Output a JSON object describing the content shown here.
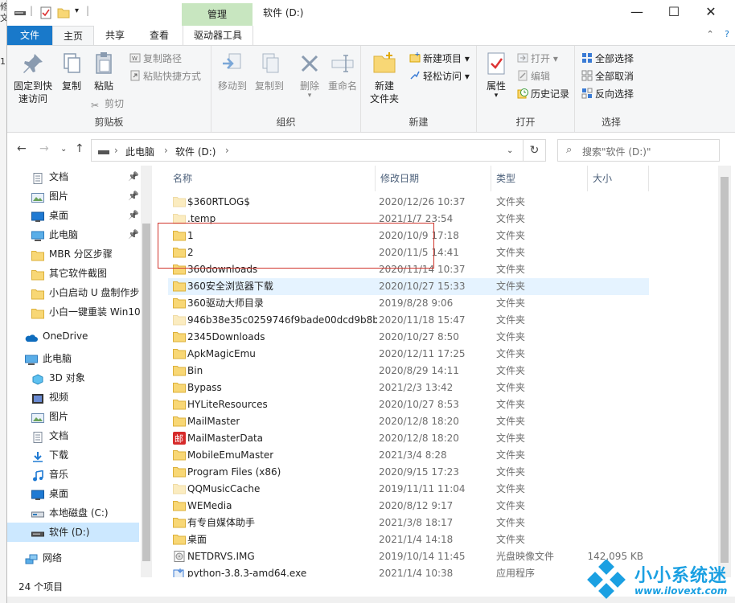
{
  "window": {
    "title": "软件 (D:)",
    "manage_tab": "管理"
  },
  "ribbon_tabs": {
    "file": "文件",
    "home": "主页",
    "share": "共享",
    "view": "查看",
    "drive_tools": "驱动器工具"
  },
  "ribbon": {
    "clipboard": {
      "label": "剪贴板",
      "pin_quick_access": "固定到快\n速访问",
      "copy": "复制",
      "paste": "粘贴",
      "copy_path": "复制路径",
      "paste_shortcut": "粘贴快捷方式",
      "cut": "剪切"
    },
    "organize": {
      "label": "组织",
      "move_to": "移动到",
      "copy_to": "复制到",
      "delete": "删除",
      "rename": "重命名"
    },
    "new": {
      "label": "新建",
      "new_folder": "新建\n文件夹",
      "new_item": "新建项目",
      "easy_access": "轻松访问"
    },
    "open": {
      "label": "打开",
      "properties": "属性",
      "open": "打开",
      "edit": "编辑",
      "history": "历史记录"
    },
    "select": {
      "label": "选择",
      "select_all": "全部选择",
      "select_none": "全部取消",
      "invert": "反向选择"
    }
  },
  "address": {
    "crumb_pc": "此电脑",
    "crumb_drive": "软件 (D:)",
    "search_placeholder": "搜索\"软件 (D:)\""
  },
  "nav_pane": {
    "quick": [
      {
        "label": "文档",
        "icon": "documents-icon",
        "pinned": true
      },
      {
        "label": "图片",
        "icon": "pictures-icon",
        "pinned": true
      },
      {
        "label": "桌面",
        "icon": "desktop-icon",
        "pinned": true
      },
      {
        "label": "此电脑",
        "icon": "this-pc-icon",
        "pinned": true
      },
      {
        "label": "MBR 分区步骤",
        "icon": "folder-icon"
      },
      {
        "label": "其它软件截图",
        "icon": "folder-icon"
      },
      {
        "label": "小白启动 U 盘制作步",
        "icon": "folder-icon"
      },
      {
        "label": "小白一键重装 Win10",
        "icon": "folder-icon"
      }
    ],
    "onedrive": "OneDrive",
    "this_pc": "此电脑",
    "pc_items": [
      {
        "label": "3D 对象",
        "icon": "3d-objects-icon"
      },
      {
        "label": "视频",
        "icon": "videos-icon"
      },
      {
        "label": "图片",
        "icon": "pictures-icon"
      },
      {
        "label": "文档",
        "icon": "documents-icon"
      },
      {
        "label": "下载",
        "icon": "downloads-icon"
      },
      {
        "label": "音乐",
        "icon": "music-icon"
      },
      {
        "label": "桌面",
        "icon": "desktop-icon"
      },
      {
        "label": "本地磁盘 (C:)",
        "icon": "local-disk-icon"
      },
      {
        "label": "软件 (D:)",
        "icon": "drive-icon",
        "selected": true
      }
    ],
    "network": "网络"
  },
  "columns": {
    "name": "名称",
    "date": "修改日期",
    "type": "类型",
    "size": "大小"
  },
  "files": [
    {
      "name": "$360RTLOG$",
      "date": "2020/12/26 10:37",
      "type": "文件夹",
      "size": "",
      "icon": "folder-icon",
      "faded": true
    },
    {
      "name": ".temp",
      "date": "2021/1/7 23:54",
      "type": "文件夹",
      "size": "",
      "icon": "folder-icon",
      "faded": true
    },
    {
      "name": "1",
      "date": "2020/10/9 17:18",
      "type": "文件夹",
      "size": "",
      "icon": "folder-icon"
    },
    {
      "name": "2",
      "date": "2020/11/5 14:41",
      "type": "文件夹",
      "size": "",
      "icon": "folder-icon"
    },
    {
      "name": "360downloads",
      "date": "2020/11/14 10:37",
      "type": "文件夹",
      "size": "",
      "icon": "folder-icon"
    },
    {
      "name": "360安全浏览器下载",
      "date": "2020/10/27 15:33",
      "type": "文件夹",
      "size": "",
      "icon": "folder-icon",
      "highlight": true
    },
    {
      "name": "360驱动大师目录",
      "date": "2019/8/28 9:06",
      "type": "文件夹",
      "size": "",
      "icon": "folder-icon"
    },
    {
      "name": "946b38e35c0259746f9bade00dcd9b8b",
      "date": "2020/11/18 15:47",
      "type": "文件夹",
      "size": "",
      "icon": "folder-icon",
      "faded": true
    },
    {
      "name": "2345Downloads",
      "date": "2020/10/27 8:50",
      "type": "文件夹",
      "size": "",
      "icon": "folder-icon"
    },
    {
      "name": "ApkMagicEmu",
      "date": "2020/12/11 17:25",
      "type": "文件夹",
      "size": "",
      "icon": "folder-icon"
    },
    {
      "name": "Bin",
      "date": "2020/8/29 14:11",
      "type": "文件夹",
      "size": "",
      "icon": "folder-icon"
    },
    {
      "name": "Bypass",
      "date": "2021/2/3 13:42",
      "type": "文件夹",
      "size": "",
      "icon": "folder-icon"
    },
    {
      "name": "HYLiteResources",
      "date": "2020/10/27 8:53",
      "type": "文件夹",
      "size": "",
      "icon": "folder-icon"
    },
    {
      "name": "MailMaster",
      "date": "2020/12/8 18:20",
      "type": "文件夹",
      "size": "",
      "icon": "folder-icon"
    },
    {
      "name": "MailMasterData",
      "date": "2020/12/8 18:20",
      "type": "文件夹",
      "size": "",
      "icon": "mail-master-icon",
      "glyph": "邮"
    },
    {
      "name": "MobileEmuMaster",
      "date": "2021/3/4 8:28",
      "type": "文件夹",
      "size": "",
      "icon": "folder-icon"
    },
    {
      "name": "Program Files (x86)",
      "date": "2020/9/15 17:23",
      "type": "文件夹",
      "size": "",
      "icon": "folder-icon"
    },
    {
      "name": "QQMusicCache",
      "date": "2019/11/11 11:04",
      "type": "文件夹",
      "size": "",
      "icon": "folder-icon",
      "faded": true
    },
    {
      "name": "WEMedia",
      "date": "2020/8/12 9:17",
      "type": "文件夹",
      "size": "",
      "icon": "folder-icon"
    },
    {
      "name": "有专自媒体助手",
      "date": "2021/3/8 18:17",
      "type": "文件夹",
      "size": "",
      "icon": "folder-icon"
    },
    {
      "name": "桌面",
      "date": "2021/1/4 14:18",
      "type": "文件夹",
      "size": "",
      "icon": "folder-icon"
    },
    {
      "name": "NETDRVS.IMG",
      "date": "2019/10/14 11:45",
      "type": "光盘映像文件",
      "size": "142,095 KB",
      "icon": "disc-image-icon"
    },
    {
      "name": "python-3.8.3-amd64.exe",
      "date": "2021/1/4 10:38",
      "type": "应用程序",
      "size": "",
      "icon": "installer-icon"
    }
  ],
  "status": {
    "count": "24 个项目"
  },
  "watermark": {
    "brand": "小小系统迷",
    "url": "www.ilovext.com"
  },
  "colors": {
    "accent": "#1979ca",
    "folder": "#f8d775",
    "highlight_box": "#d0342c",
    "selected": "#cce8ff",
    "watermark": "#1ba0e2"
  }
}
